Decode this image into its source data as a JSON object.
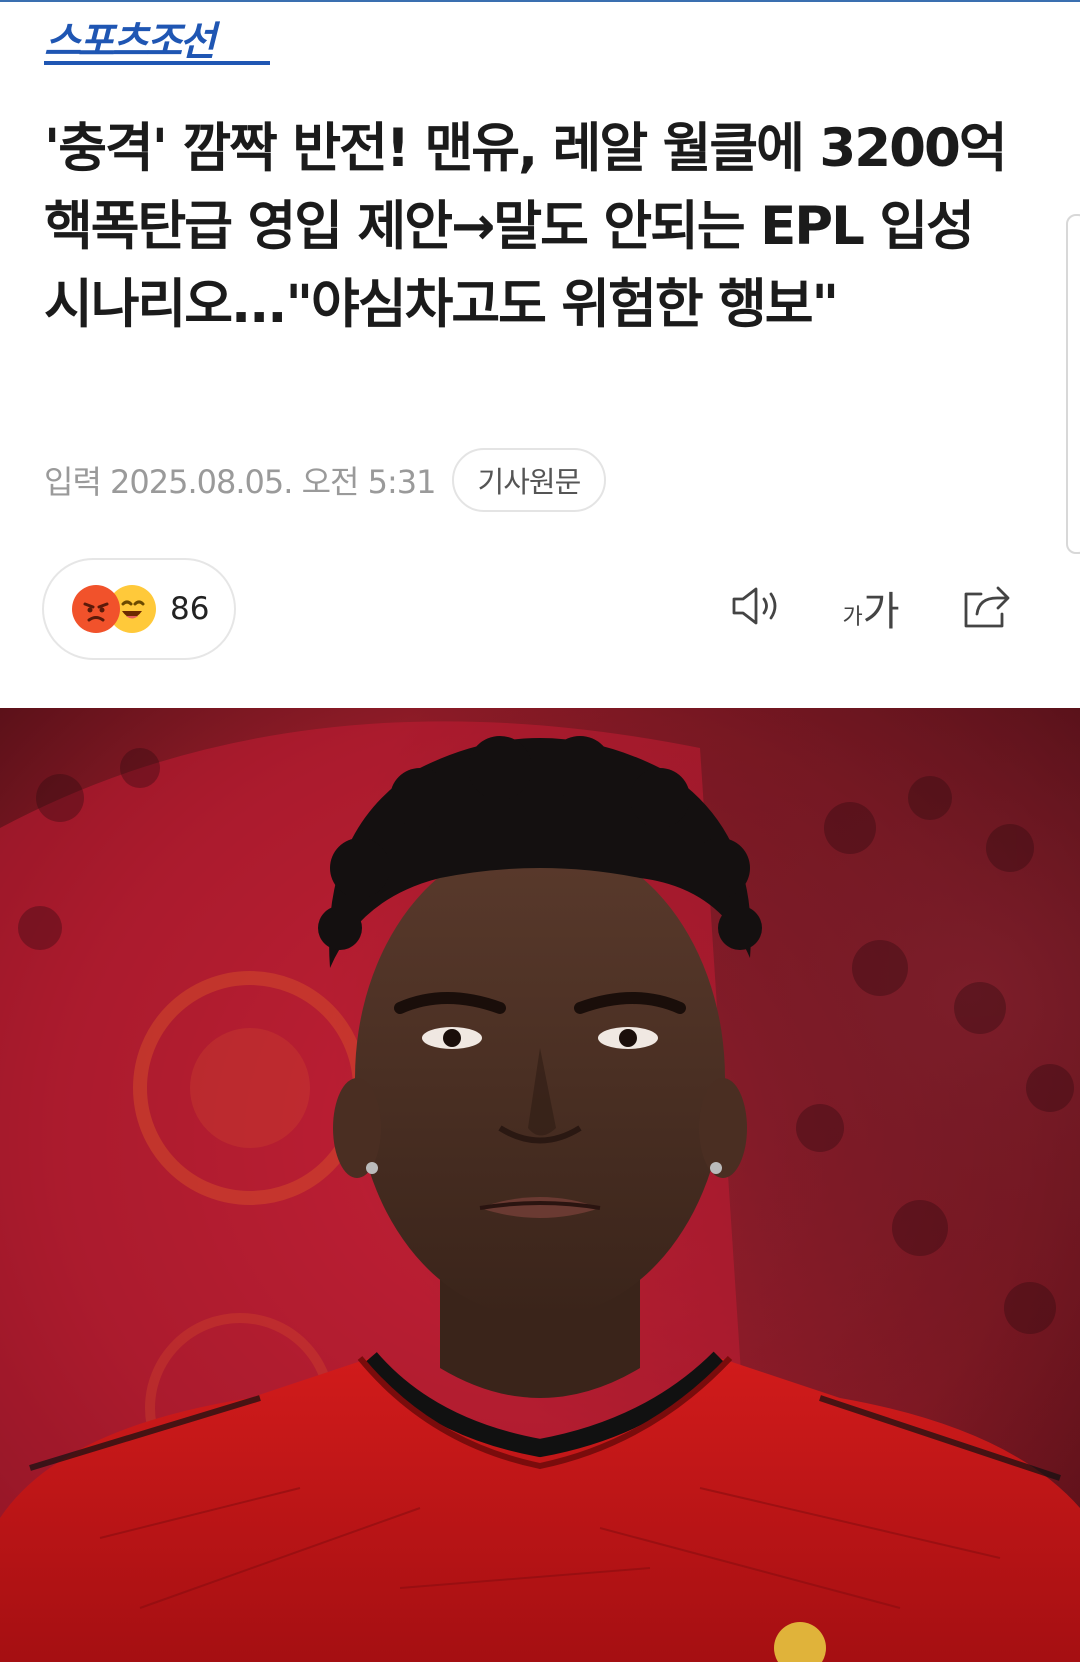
{
  "brand": {
    "name": "스포츠조선"
  },
  "article": {
    "headline": "'충격' 깜짝 반전! 맨유, 레알 월클에 3200억 핵폭탄급 영입 제안→말도 안되는 EPL 입성 시나리오...\"야심차고도 위험한 행보\"",
    "byline": "입력 2025.08.05. 오전 5:31",
    "origin_button": "기사원문"
  },
  "reactions": {
    "count": "86",
    "icons": [
      "angry-face-icon",
      "laughing-face-icon"
    ]
  },
  "toolbar": {
    "speaker_icon": "speaker-icon",
    "font_small": "가",
    "font_big": "가",
    "share_icon": "share-icon"
  },
  "hero_image": {
    "subject": "football-player-photo"
  },
  "colors": {
    "brand": "#1f56b3",
    "headline": "#1b1b1b",
    "byline": "#9a9a9a",
    "hero_red": "#c8102e"
  }
}
